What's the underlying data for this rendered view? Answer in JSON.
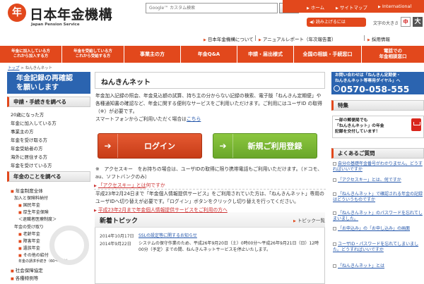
{
  "header": {
    "logo_mark": "年",
    "logo_text": "日本年金機構",
    "logo_sub": "Japan Pension Service",
    "search_placeholder": "Google™ カスタム検索",
    "search_button": "検索",
    "top_links": [
      "ホーム",
      "サイトマップ",
      "International"
    ],
    "voice_button": "読み上げるには",
    "font_size_label": "文字の大きさ",
    "font_size_mid": "中",
    "font_size_large": "大",
    "sub_links": [
      "日本年金機構について",
      "アニュアルレポート（年次報告書）",
      "採用情報"
    ]
  },
  "gnav": [
    {
      "label": "年金に加入している方\nこれから加入する方"
    },
    {
      "label": "年金を受給している方\nこれから受給する方"
    },
    {
      "label": "事業主の方"
    },
    {
      "label": "年金Q&A"
    },
    {
      "label": "申請・届出様式"
    },
    {
      "label": "全国の相談・手続窓口"
    },
    {
      "label": "電話での\n年金相談窓口"
    }
  ],
  "breadcrumb": {
    "home": "トップ",
    "current": "ねんきんネット"
  },
  "left": {
    "banner": "年金記録の再確認\nを願いします",
    "head1": "申請・手続きを調べる",
    "items1": [
      "20歳になった方",
      "年金に加入している方",
      "事業主の方",
      "年金を受け取る方",
      "年金受給者の方",
      "海外に居住する方",
      "年金を受けている方"
    ],
    "head2": "年金のことを調べる",
    "items2": [
      "年金制度全体",
      "加入と保険料納付",
      "国民年金",
      "厚生年金保険",
      "＜退職者医療制度＞",
      "年金の受け取り",
      "老齢年金",
      "障害年金",
      "遺族年金",
      "その他の給付",
      "年金の請求手続き（60〜65歳）",
      "社会保障協定",
      "各種特例等"
    ]
  },
  "main": {
    "title": "ねんきんネット",
    "intro_text": "年金加入記録の照会、年金見込額の試算、持ち主の分からない記録の検索、電子版「ねんきん定期便」や各種通知書の確認など、年金に関する便利なサービスをご利用いただけます。ご利用にはユーザID の取得（※）が必要です。",
    "intro_sp": "スマートフォンからご利用いただく場合は",
    "intro_sp_link": "こちら",
    "login_button": "ログイン",
    "register_button": "新規ご利用登録",
    "note": "※　アクセスキー　をお持ちの場合は、ユーザIDの取得に限り携帯電話もご利用いただけます。（ドコモ、au、ソフトバンクのみ）",
    "access_key_link": "「アクセスキー」とは",
    "access_key_tail": "何ですか",
    "switch_text": "平成23年2月24日まで「年金個人情報提供サービス」をご利用されていた方は、「ねんきんネット」専用のユーザIDへ切り替えが必要です。「ログイン」ボタンをクリックし切り替えを行ってください。",
    "switch_link": "平成23年2月まで年金個人情報提供サービスをご利用の方へ",
    "news_title": "新着トピック",
    "news_more": "トピック一覧",
    "news": [
      {
        "date": "2014年10月17日",
        "text": "SSLの設定等に関するお知らせ"
      },
      {
        "date": "2014年9月22日",
        "text": "システムの保守作業のため、平成26年9月20日（土）0時00分〜平成26年9月21日（日）12時00分（予定）までの間、ねんきんネットサービスを停止いたします。"
      }
    ]
  },
  "right": {
    "contact_text": "お問い合わせは「ねんきん定期便・\nねんきんネット等専用ダイヤル」へ",
    "contact_phone": "0570-058-555",
    "head1": "特集",
    "mail_text": "一部の郵便局でも\n「ねんきんネット」の年金\n記録を交付しています！",
    "head2": "よくあるご質問",
    "faqs": [
      "自分の基礎年金番号がわかりません。どうすればいいですか",
      "「アクセスキー」とは、何ですか",
      "「ねんきんネット」で確認される年金の記録はどういうものですか",
      "「ねんきんネット」のパスワードを忘れてしまいました。",
      "「お申込み」の「お申し込み」の画面",
      "ユーザID・パスワードを忘れてしまいました。どうすればいいですか",
      "「ねんきんネット」とは"
    ]
  }
}
